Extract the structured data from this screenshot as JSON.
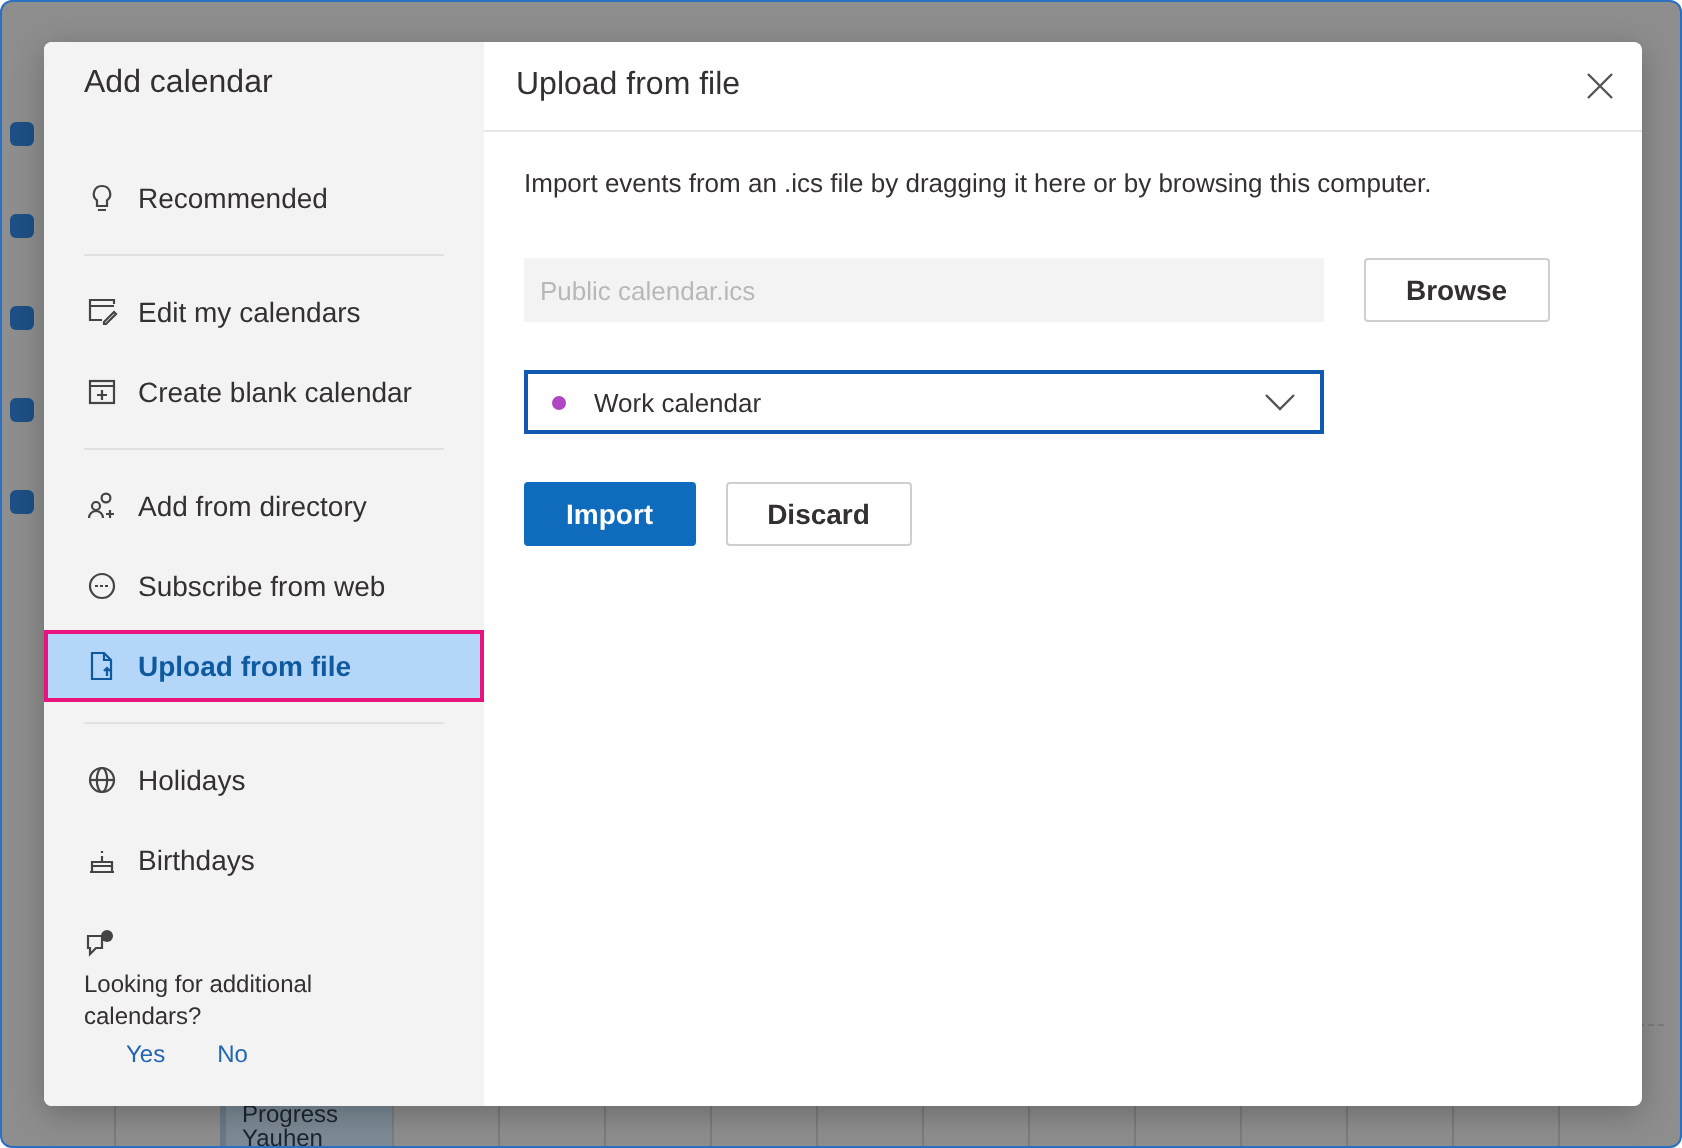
{
  "background": {
    "event": {
      "title": "Progress",
      "subtitle": "Yauhen"
    }
  },
  "dialog": {
    "sidebar_title": "Add calendar",
    "sidebar_groups": [
      {
        "items": [
          {
            "kind": "bulb",
            "label": "Recommended",
            "selected": false
          }
        ]
      },
      {
        "items": [
          {
            "kind": "edit",
            "label": "Edit my calendars",
            "selected": false
          },
          {
            "kind": "blank",
            "label": "Create blank calendar",
            "selected": false
          }
        ]
      },
      {
        "items": [
          {
            "kind": "directory",
            "label": "Add from directory",
            "selected": false
          },
          {
            "kind": "web",
            "label": "Subscribe from web",
            "selected": false
          },
          {
            "kind": "file",
            "label": "Upload from file",
            "selected": true
          }
        ]
      },
      {
        "items": [
          {
            "kind": "globe",
            "label": "Holidays",
            "selected": false
          },
          {
            "kind": "cake",
            "label": "Birthdays",
            "selected": false
          }
        ]
      }
    ],
    "feedback": {
      "question": "Looking for additional calendars?",
      "yes": "Yes",
      "no": "No"
    },
    "title": "Upload from file",
    "description": "Import events from an .ics file by dragging it here or by browsing this computer.",
    "file_field": {
      "placeholder": "Public calendar.ics"
    },
    "browse_button": "Browse",
    "calendar_select": {
      "value": "Work calendar",
      "color": "#b146c2"
    },
    "buttons": [
      {
        "label": "Import",
        "kind": "primary"
      },
      {
        "label": "Discard",
        "kind": "secondary"
      }
    ]
  }
}
